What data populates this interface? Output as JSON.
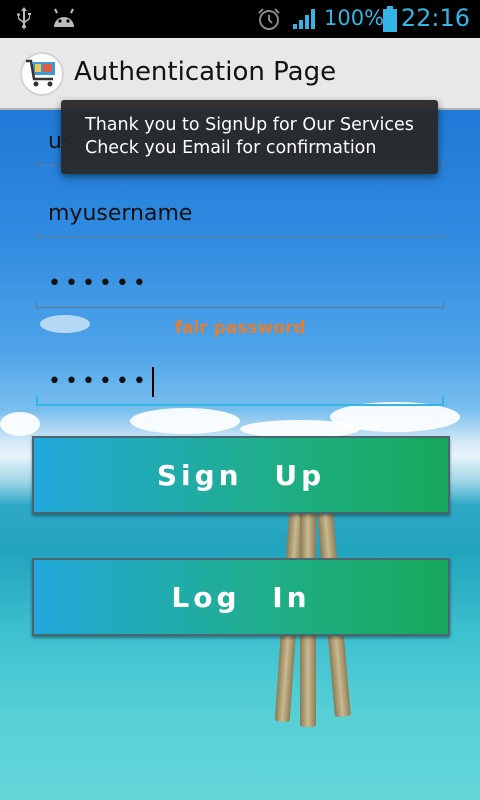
{
  "status_bar": {
    "battery_text": "100%",
    "time": "22:16",
    "icons": [
      "usb-icon",
      "android-debug-icon",
      "alarm-icon",
      "signal-icon",
      "battery-icon"
    ],
    "color": "#33b5e5"
  },
  "action_bar": {
    "title": "Authentication Page",
    "app_icon": "shopping-cart-icon"
  },
  "form": {
    "email_field_partial": "us",
    "username_value": "myusername",
    "password_value": "••••••",
    "password_strength": "fair password",
    "confirm_password_value": "••••••"
  },
  "buttons": {
    "sign_up": "Sign Up",
    "log_in": "Log In"
  },
  "toast": {
    "line1": "Thank you to SignUp for Our Services",
    "line2": "Check you Email for confirmation"
  },
  "colors": {
    "accent": "#33b5e5",
    "hint": "#e07f35",
    "button_gradient_start": "#22a8db",
    "button_gradient_end": "#17a85a"
  }
}
